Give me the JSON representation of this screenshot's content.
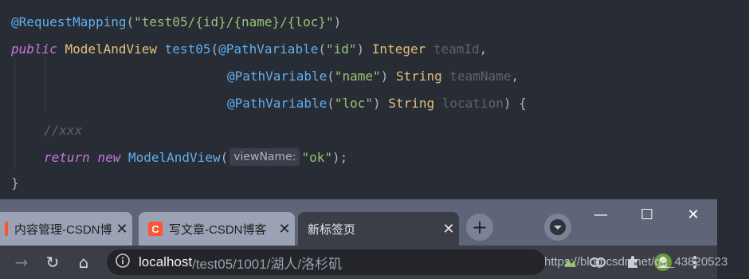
{
  "editor": {
    "line1": {
      "annotation": "@RequestMapping",
      "paren_open": "(",
      "path": "\"test05/{id}/{name}/{loc}\"",
      "paren_close": ")"
    },
    "line2": {
      "kw_public": "public",
      "ret_type": "ModelAndView",
      "method": "test05",
      "paren": "(",
      "annotation": "@PathVariable",
      "arg_open": "(",
      "arg": "\"id\"",
      "arg_close": ")",
      "type": "Integer",
      "param": "teamId",
      "comma": ","
    },
    "line3": {
      "annotation": "@PathVariable",
      "arg_open": "(",
      "arg": "\"name\"",
      "arg_close": ")",
      "type": "String",
      "param": "teamName",
      "comma": ","
    },
    "line4": {
      "annotation": "@PathVariable",
      "arg_open": "(",
      "arg": "\"loc\"",
      "arg_close": ")",
      "type": "String",
      "param": "location",
      "close": ") {"
    },
    "line5": {
      "comment": "//xxx"
    },
    "line6": {
      "kw_return": "return",
      "kw_new": "new",
      "cls": "ModelAndView",
      "paren": "(",
      "hint": "viewName:",
      "arg": "\"ok\"",
      "end": ");"
    },
    "line7": {
      "brace": "}"
    }
  },
  "browser": {
    "tabs": [
      {
        "label": "内容管理-CSDN博",
        "favicon": "",
        "close": "✕",
        "active": false
      },
      {
        "label": "写文章-CSDN博客",
        "favicon": "C",
        "close": "✕",
        "active": false
      },
      {
        "label": "新标签页",
        "favicon": "",
        "close": "✕",
        "active": true
      }
    ],
    "new_tab": "+",
    "window_controls": {
      "minimize": "—",
      "maximize": "☐",
      "close": "✕"
    },
    "profile_icon": "profile-menu-icon",
    "toolbar": {
      "back": "→",
      "reload": "↻",
      "home": "⌂",
      "url_host": "localhost",
      "url_path": "/test05/1001/湖人/洛杉矶",
      "url_icon": "site-info-icon"
    },
    "watermark": "https://blog.csdn.net/qq_43820523"
  },
  "colors": {
    "editor_bg": "#282c34",
    "annotation": "#61afef",
    "string": "#98c379",
    "keyword": "#c678dd",
    "type": "#e5c07b",
    "param": "#5c6370",
    "tabstrip": "#5e6579",
    "active_tab": "#3b3e46",
    "csdn_red": "#fc5531"
  }
}
